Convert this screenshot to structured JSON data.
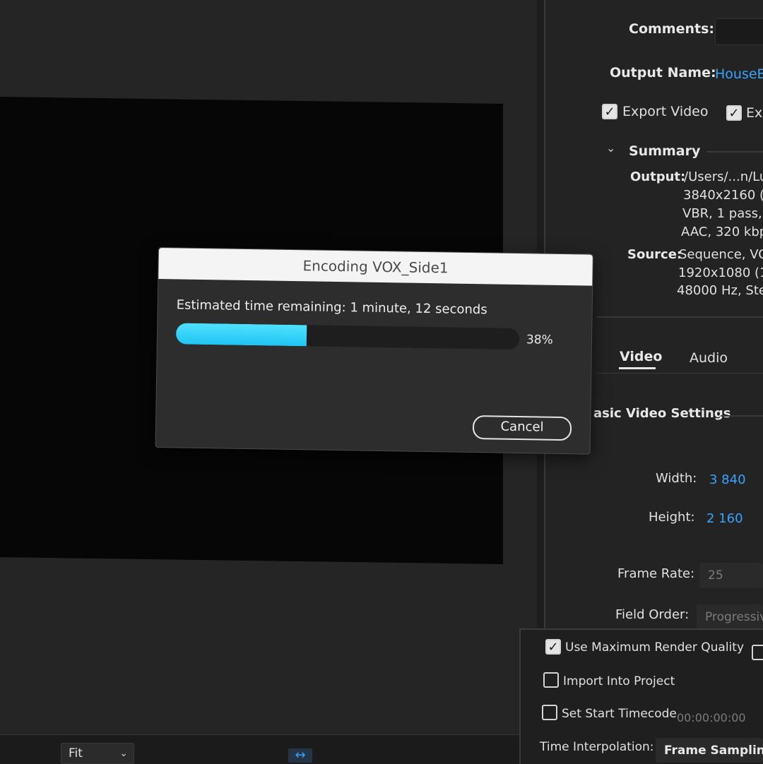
{
  "right_panel": {
    "comments_label": "Comments:",
    "output_name_label": "Output Name:",
    "output_name_value": "HouseB",
    "export_video_label": "Export Video",
    "export_audio_partial": "Ex",
    "summary_label": "Summary",
    "output_label": "Output:",
    "output_lines": [
      "/Users/...n/Lu",
      "3840x2160 (",
      "VBR, 1 pass, ",
      "AAC, 320 kbp"
    ],
    "source_label": "Source:",
    "source_lines": [
      "Sequence, VO",
      "1920x1080 (1",
      "48000 Hz, Ste"
    ],
    "tabs": [
      "Video",
      "Audio"
    ],
    "section_title": "asic Video Settings",
    "width_label": "Width:",
    "width_value": "3 840",
    "height_label": "Height:",
    "height_value": "2 160",
    "frame_rate_label": "Frame Rate:",
    "frame_rate_value": "25",
    "field_order_label": "Field Order:",
    "field_order_value": "Progressiv"
  },
  "bottom_options": {
    "max_render_quality": "Use Maximum Render Quality",
    "import_into_project": "Import Into Project",
    "set_start_timecode": "Set Start Timecode",
    "timecode_value": "00:00:00:00",
    "time_interpolation_label": "Time Interpolation:",
    "time_interpolation_value": "Frame Sampling"
  },
  "preview": {
    "fit_value": "Fit"
  },
  "dialog": {
    "title": "Encoding VOX_Side1",
    "estimate": "Estimated time remaining: 1 minute, 12 seconds",
    "progress_percent": 38,
    "progress_label": "38%",
    "cancel_label": "Cancel"
  },
  "colors": {
    "accent_blue": "#39a4ff",
    "progress_cyan": "#2fd0f8"
  }
}
